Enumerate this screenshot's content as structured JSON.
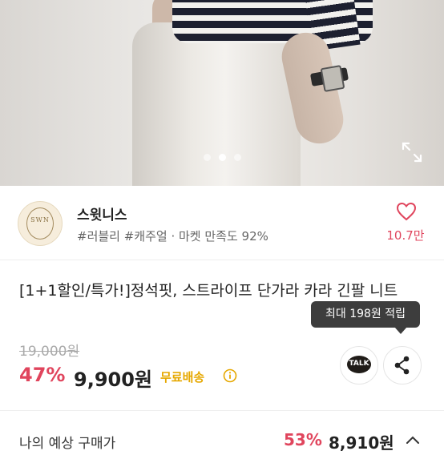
{
  "hero": {
    "image_alt": "product-photo",
    "carousel": {
      "total": 3,
      "active_index": 1
    }
  },
  "seller": {
    "logo_text": "SWN",
    "name": "스윗니스",
    "tags": "#러블리 #캐주얼 · 마켓 만족도 92%",
    "like_count": "10.7만"
  },
  "product": {
    "title": "[1+1할인/특가!]정석핏, 스트라이프 단가라 카라 긴팔 니트",
    "tooltip": "최대 198원 적립",
    "original_price": "19,000원",
    "discount": "47%",
    "price": "9,900원",
    "shipping": "무료배송",
    "talk_label": "TALK"
  },
  "expected": {
    "label": "나의 예상 구매가",
    "discount": "53%",
    "price": "8,910원"
  },
  "colors": {
    "accent": "#e0455d",
    "shipping": "#e6a800",
    "tooltip_bg": "#3d3d3d"
  }
}
